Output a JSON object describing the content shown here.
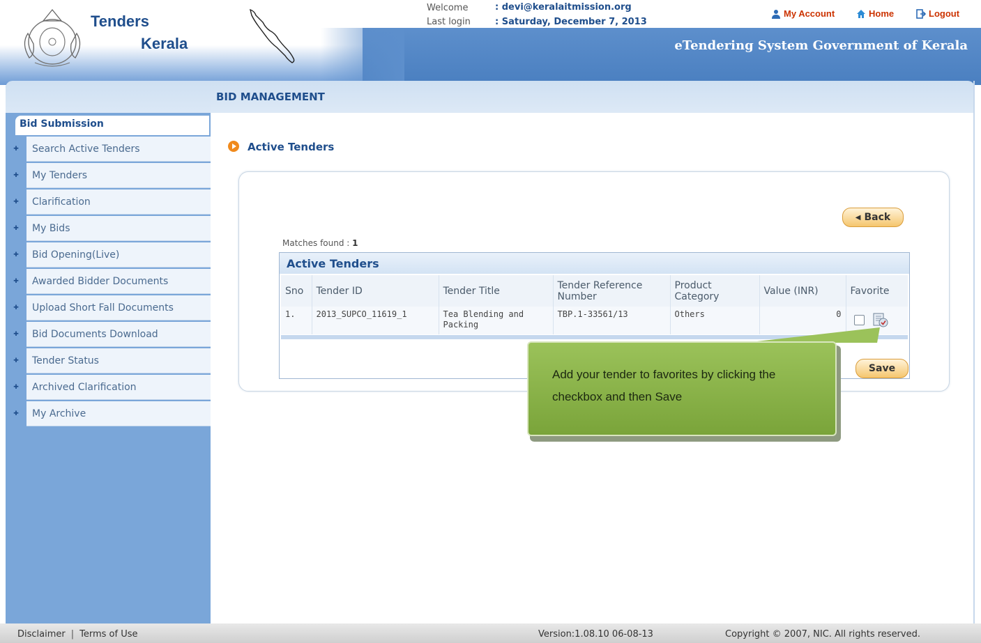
{
  "header": {
    "brand_line1": "Tenders",
    "brand_line2": "Kerala",
    "welcome_label": "Welcome",
    "welcome_value": ": devi@keralaitmission.org",
    "lastlogin_label": "Last login",
    "lastlogin_value": ": Saturday, December 7, 2013",
    "links": {
      "my_account": "My Account",
      "home": "Home",
      "logout": "Logout"
    },
    "system_title": "eTendering System Government of Kerala"
  },
  "page": {
    "title": "BID MANAGEMENT",
    "section_title": "Active Tenders"
  },
  "sidebar": {
    "heading": "Bid Submission",
    "items": [
      {
        "label": "Search Active Tenders"
      },
      {
        "label": "My Tenders"
      },
      {
        "label": "Clarification"
      },
      {
        "label": "My Bids"
      },
      {
        "label": "Bid Opening(Live)"
      },
      {
        "label": "Awarded Bidder Documents"
      },
      {
        "label": "Upload Short Fall Documents"
      },
      {
        "label": "Bid Documents Download"
      },
      {
        "label": "Tender Status"
      },
      {
        "label": "Archived Clarification"
      },
      {
        "label": "My Archive"
      }
    ]
  },
  "buttons": {
    "back": "Back",
    "save": "Save"
  },
  "results": {
    "matches_label": "Matches found :",
    "matches_count": "1",
    "caption": "Active Tenders",
    "columns": [
      "Sno",
      "Tender ID",
      "Tender Title",
      "Tender Reference Number",
      "Product Category",
      "Value (INR)",
      "Favorite"
    ],
    "rows": [
      {
        "sno": "1.",
        "tender_id": "2013_SUPCO_11619_1",
        "title": "Tea Blending and Packing",
        "reference": "TBP.1-33561/13",
        "category": "Others",
        "value": "0"
      }
    ]
  },
  "callout": {
    "text": "Add your tender to favorites by clicking the checkbox and then Save"
  },
  "footer": {
    "disclaimer": "Disclaimer",
    "separator": "|",
    "terms": "Terms of Use",
    "version": "Version:1.08.10 06-08-13",
    "copyright": "Copyright © 2007, NIC. All rights reserved."
  },
  "colors": {
    "brand_blue": "#1f4e8c",
    "header_blue": "#4f87c8",
    "sidebar_blue": "#7aa6d9",
    "link_red": "#cc3300",
    "button_orange": "#f5c66e",
    "callout_green": "#8ab54a"
  },
  "icons": {
    "account": "user-icon",
    "home": "home-icon",
    "logout": "logout-icon",
    "emblem": "kerala-emblem-icon",
    "map": "kerala-map-icon",
    "bullet": "orange-arrow-bullet-icon",
    "favorite": "favorite-document-icon"
  }
}
